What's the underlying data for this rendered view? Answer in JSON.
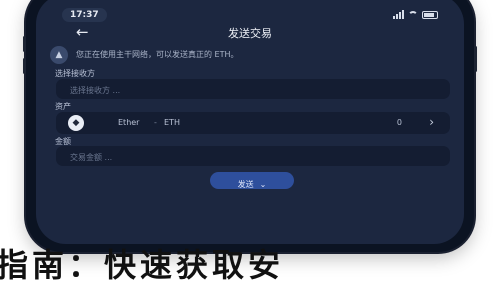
{
  "status_bar": {
    "time": "17:37"
  },
  "header": {
    "back_icon": "back-arrow-icon",
    "title": "发送交易"
  },
  "warning": {
    "icon": "warning-icon",
    "text": "您正在使用主干网络，可以发送真正的 ETH。"
  },
  "network": {
    "label": "选择接收方",
    "placeholder": "选择接收方 ..."
  },
  "asset": {
    "label": "资产",
    "name": "Ether",
    "separator": "-",
    "symbol": "ETH",
    "balance": "0",
    "icon": "ethereum-icon"
  },
  "address": {
    "label": "金额",
    "placeholder": "交易金额 ..."
  },
  "confirm": {
    "label": "发送",
    "chevron": "⌄"
  },
  "caption": {
    "text": "指南：快速获取安"
  },
  "colors": {
    "screen_bg": "#1c2740",
    "field_bg": "#141d32",
    "accent": "#2e4f9c"
  }
}
